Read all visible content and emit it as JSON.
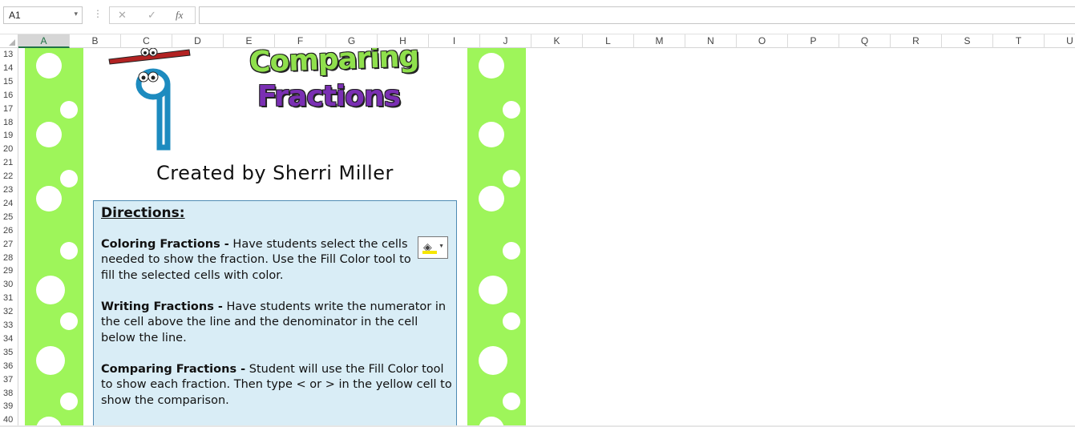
{
  "formula_bar": {
    "name_box": "A1",
    "name_box_arrow": "▾",
    "separator": "⋮",
    "cancel_icon": "✕",
    "enter_icon": "✓",
    "fx_icon": "fx",
    "formula": ""
  },
  "columns": [
    "A",
    "B",
    "C",
    "D",
    "E",
    "F",
    "G",
    "H",
    "I",
    "J",
    "K",
    "L",
    "M",
    "N",
    "O",
    "P",
    "Q",
    "R",
    "S",
    "T",
    "U"
  ],
  "selected_column": "A",
  "rows": [
    "13",
    "14",
    "15",
    "16",
    "17",
    "18",
    "19",
    "20",
    "21",
    "22",
    "23",
    "24",
    "25",
    "26",
    "27",
    "28",
    "29",
    "30",
    "31",
    "32",
    "33",
    "34",
    "35",
    "36",
    "37",
    "38",
    "39",
    "40"
  ],
  "sheet": {
    "title_line1": "Comparing",
    "title_line2": "Fractions",
    "credit": "Created by Sherri Miller",
    "stripe_color": "#9ef55a",
    "directions": {
      "title": "Directions:",
      "coloring_head": "Coloring Fractions -",
      "coloring_body": " Have students select the cells needed to show the fraction. Use the Fill Color tool to fill the selected cells with color.",
      "writing_head": "Writing Fractions -",
      "writing_body": " Have students write the numerator in the cell above the line and the denominator in the cell below the line.",
      "comparing_head": "Comparing Fractions -",
      "comparing_body": " Student will use the Fill Color tool to show each fraction.  Then type < or > in the yellow cell to show the comparison.",
      "fill_tool_icon": "paint-bucket-icon",
      "box_color": "#d9edf6"
    }
  }
}
